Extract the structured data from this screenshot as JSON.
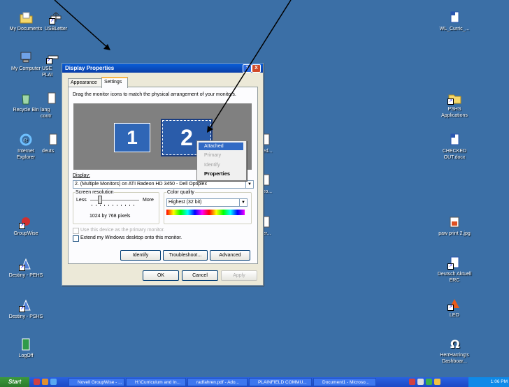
{
  "desktop_icons": {
    "my_documents": "My Documents",
    "usbletter": "USBLetter",
    "my_computer": "My Computer",
    "usb_plain_1": "USE",
    "usb_plain_2": "PLAI",
    "recycle_bin": "Recycle Bin",
    "language_1": "lang",
    "language_2": "contr",
    "internet_explorer_1": "Internet",
    "internet_explorer_2": "Explorer",
    "deuts": "deuts",
    "groupwise": "GroupWise",
    "destiny_pehs": "Destiny - PEHS",
    "destiny_pshs": "Destiny - PSHS",
    "logoff": "LogOff",
    "wl_curric": "WL_Curric_...",
    "pshs_apps_1": "PSHS",
    "pshs_apps_2": "Applications",
    "checked_out_1": "CHECKED",
    "checked_out_2": "OUT.docx",
    "paw_print": "paw print 2.jpg",
    "deutsch_aktuell_1": "Deutsch Aktuell",
    "deutsch_aktuell_2": "ERC",
    "leo": "LEO",
    "herrharring_1": "HerrHarring's",
    "herrharring_2": "Dashboar...",
    "ried": "ried...",
    "iteo": "iteo...",
    "der": "der..."
  },
  "dialog": {
    "title": "Display Properties",
    "help_btn": "?",
    "close_btn": "X",
    "tabs": [
      "Appearance",
      "Settings"
    ],
    "instruction": "Drag the monitor icons to match the physical arrangement of your monitors.",
    "monitor_1": "1",
    "monitor_2": "2",
    "context_menu": [
      "Attached",
      "Primary",
      "Identify",
      "Properties"
    ],
    "display_label": "Display:",
    "display_value": "2. (Multiple Monitors) on ATI Radeon HD 3450 - Dell Optiplex",
    "screen_resolution_label": "Screen resolution",
    "less": "Less",
    "more": "More",
    "resolution_value": "1024 by 768 pixels",
    "color_quality_label": "Color quality",
    "color_quality_value": "Highest (32 bit)",
    "primary_check": "Use this device as the primary monitor.",
    "extend_check": "Extend my Windows desktop onto this monitor.",
    "identify_btn": "Identify",
    "troubleshoot_btn": "Troubleshoot...",
    "advanced_btn": "Advanced",
    "ok_btn": "OK",
    "cancel_btn": "Cancel",
    "apply_btn": "Apply"
  },
  "taskbar": {
    "start": "Start",
    "tasks": [
      "Novell GroupWise - ...",
      "H:\\Curriculum and In...",
      "radfahren.pdf - Ado...",
      "PLAINFIELD COMMU...",
      "Document1 - Microso..."
    ],
    "clock": "1:06 PM"
  },
  "colors": {
    "desktop": "#3b6fa6",
    "titlebar": "#0a4fc8",
    "monitor_selected": "#2a5caa"
  }
}
